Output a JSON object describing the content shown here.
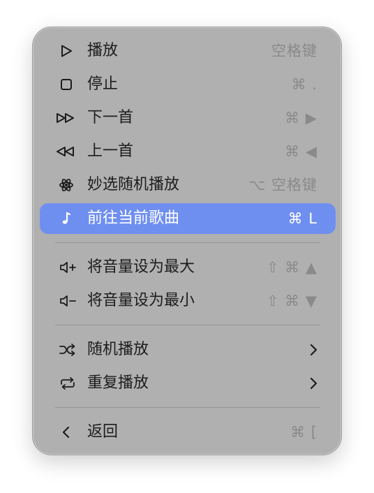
{
  "menu": {
    "items": [
      {
        "label": "播放",
        "shortcut": "空格键",
        "icon": "play-icon"
      },
      {
        "label": "停止",
        "shortcut": "⌘ .",
        "icon": "stop-icon"
      },
      {
        "label": "下一首",
        "shortcut": "⌘ ▶",
        "icon": "next-track-icon"
      },
      {
        "label": "上一首",
        "shortcut": "⌘ ◀",
        "icon": "previous-track-icon"
      },
      {
        "label": "妙选随机播放",
        "shortcut": "⌥ 空格键",
        "icon": "atom-icon"
      },
      {
        "label": "前往当前歌曲",
        "shortcut": "⌘ L",
        "icon": "music-note-icon",
        "highlighted": true
      },
      {
        "label": "将音量设为最大",
        "shortcut": "⇧ ⌘ ▲",
        "icon": "volume-up-icon"
      },
      {
        "label": "将音量设为最小",
        "shortcut": "⇧ ⌘ ▼",
        "icon": "volume-down-icon"
      },
      {
        "label": "随机播放",
        "icon": "shuffle-icon",
        "submenu": true
      },
      {
        "label": "重复播放",
        "icon": "repeat-icon",
        "submenu": true
      },
      {
        "label": "返回",
        "shortcut": "⌘ [",
        "icon": "back-chevron-icon"
      }
    ]
  },
  "colors": {
    "menu_background": "#b0b0b0",
    "highlight": "#6f8ff0",
    "label_text": "#1c1c1c",
    "shortcut_text": "#8a8a8a"
  }
}
